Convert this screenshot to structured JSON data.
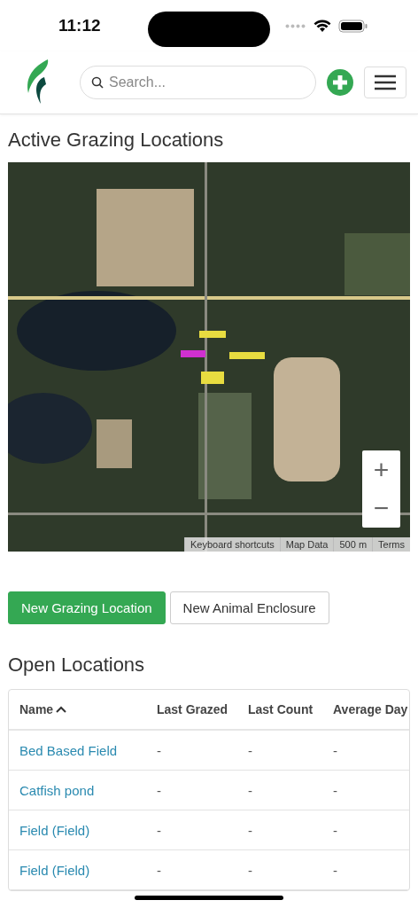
{
  "status_bar": {
    "time": "11:12"
  },
  "header": {
    "search": {
      "placeholder": "Search..."
    }
  },
  "title": "Active Grazing Locations",
  "map": {
    "kind": "picture",
    "zoom_in": "+",
    "zoom_out": "−",
    "attribution": [
      "Keyboard shortcuts",
      "Map Data",
      "500 m",
      "Terms"
    ]
  },
  "actions": [
    {
      "label": "New Grazing Location",
      "kind": "primary"
    },
    {
      "label": "New Animal Enclosure",
      "kind": "secondary"
    }
  ],
  "section_title": "Open Locations",
  "table": {
    "columns": [
      {
        "label": "Name",
        "sorted": true
      },
      {
        "label": "Last Grazed",
        "sorted": false
      },
      {
        "label": "Last Count",
        "sorted": false
      },
      {
        "label": "Average Day",
        "sorted": false
      }
    ],
    "rows": [
      [
        "Bed Based Field",
        "-",
        "-",
        "-"
      ],
      [
        "Catfish pond",
        "-",
        "-",
        "-"
      ],
      [
        "Field (Field)",
        "-",
        "-",
        "-"
      ],
      [
        "Field (Field)",
        "-",
        "-",
        "-"
      ]
    ]
  }
}
